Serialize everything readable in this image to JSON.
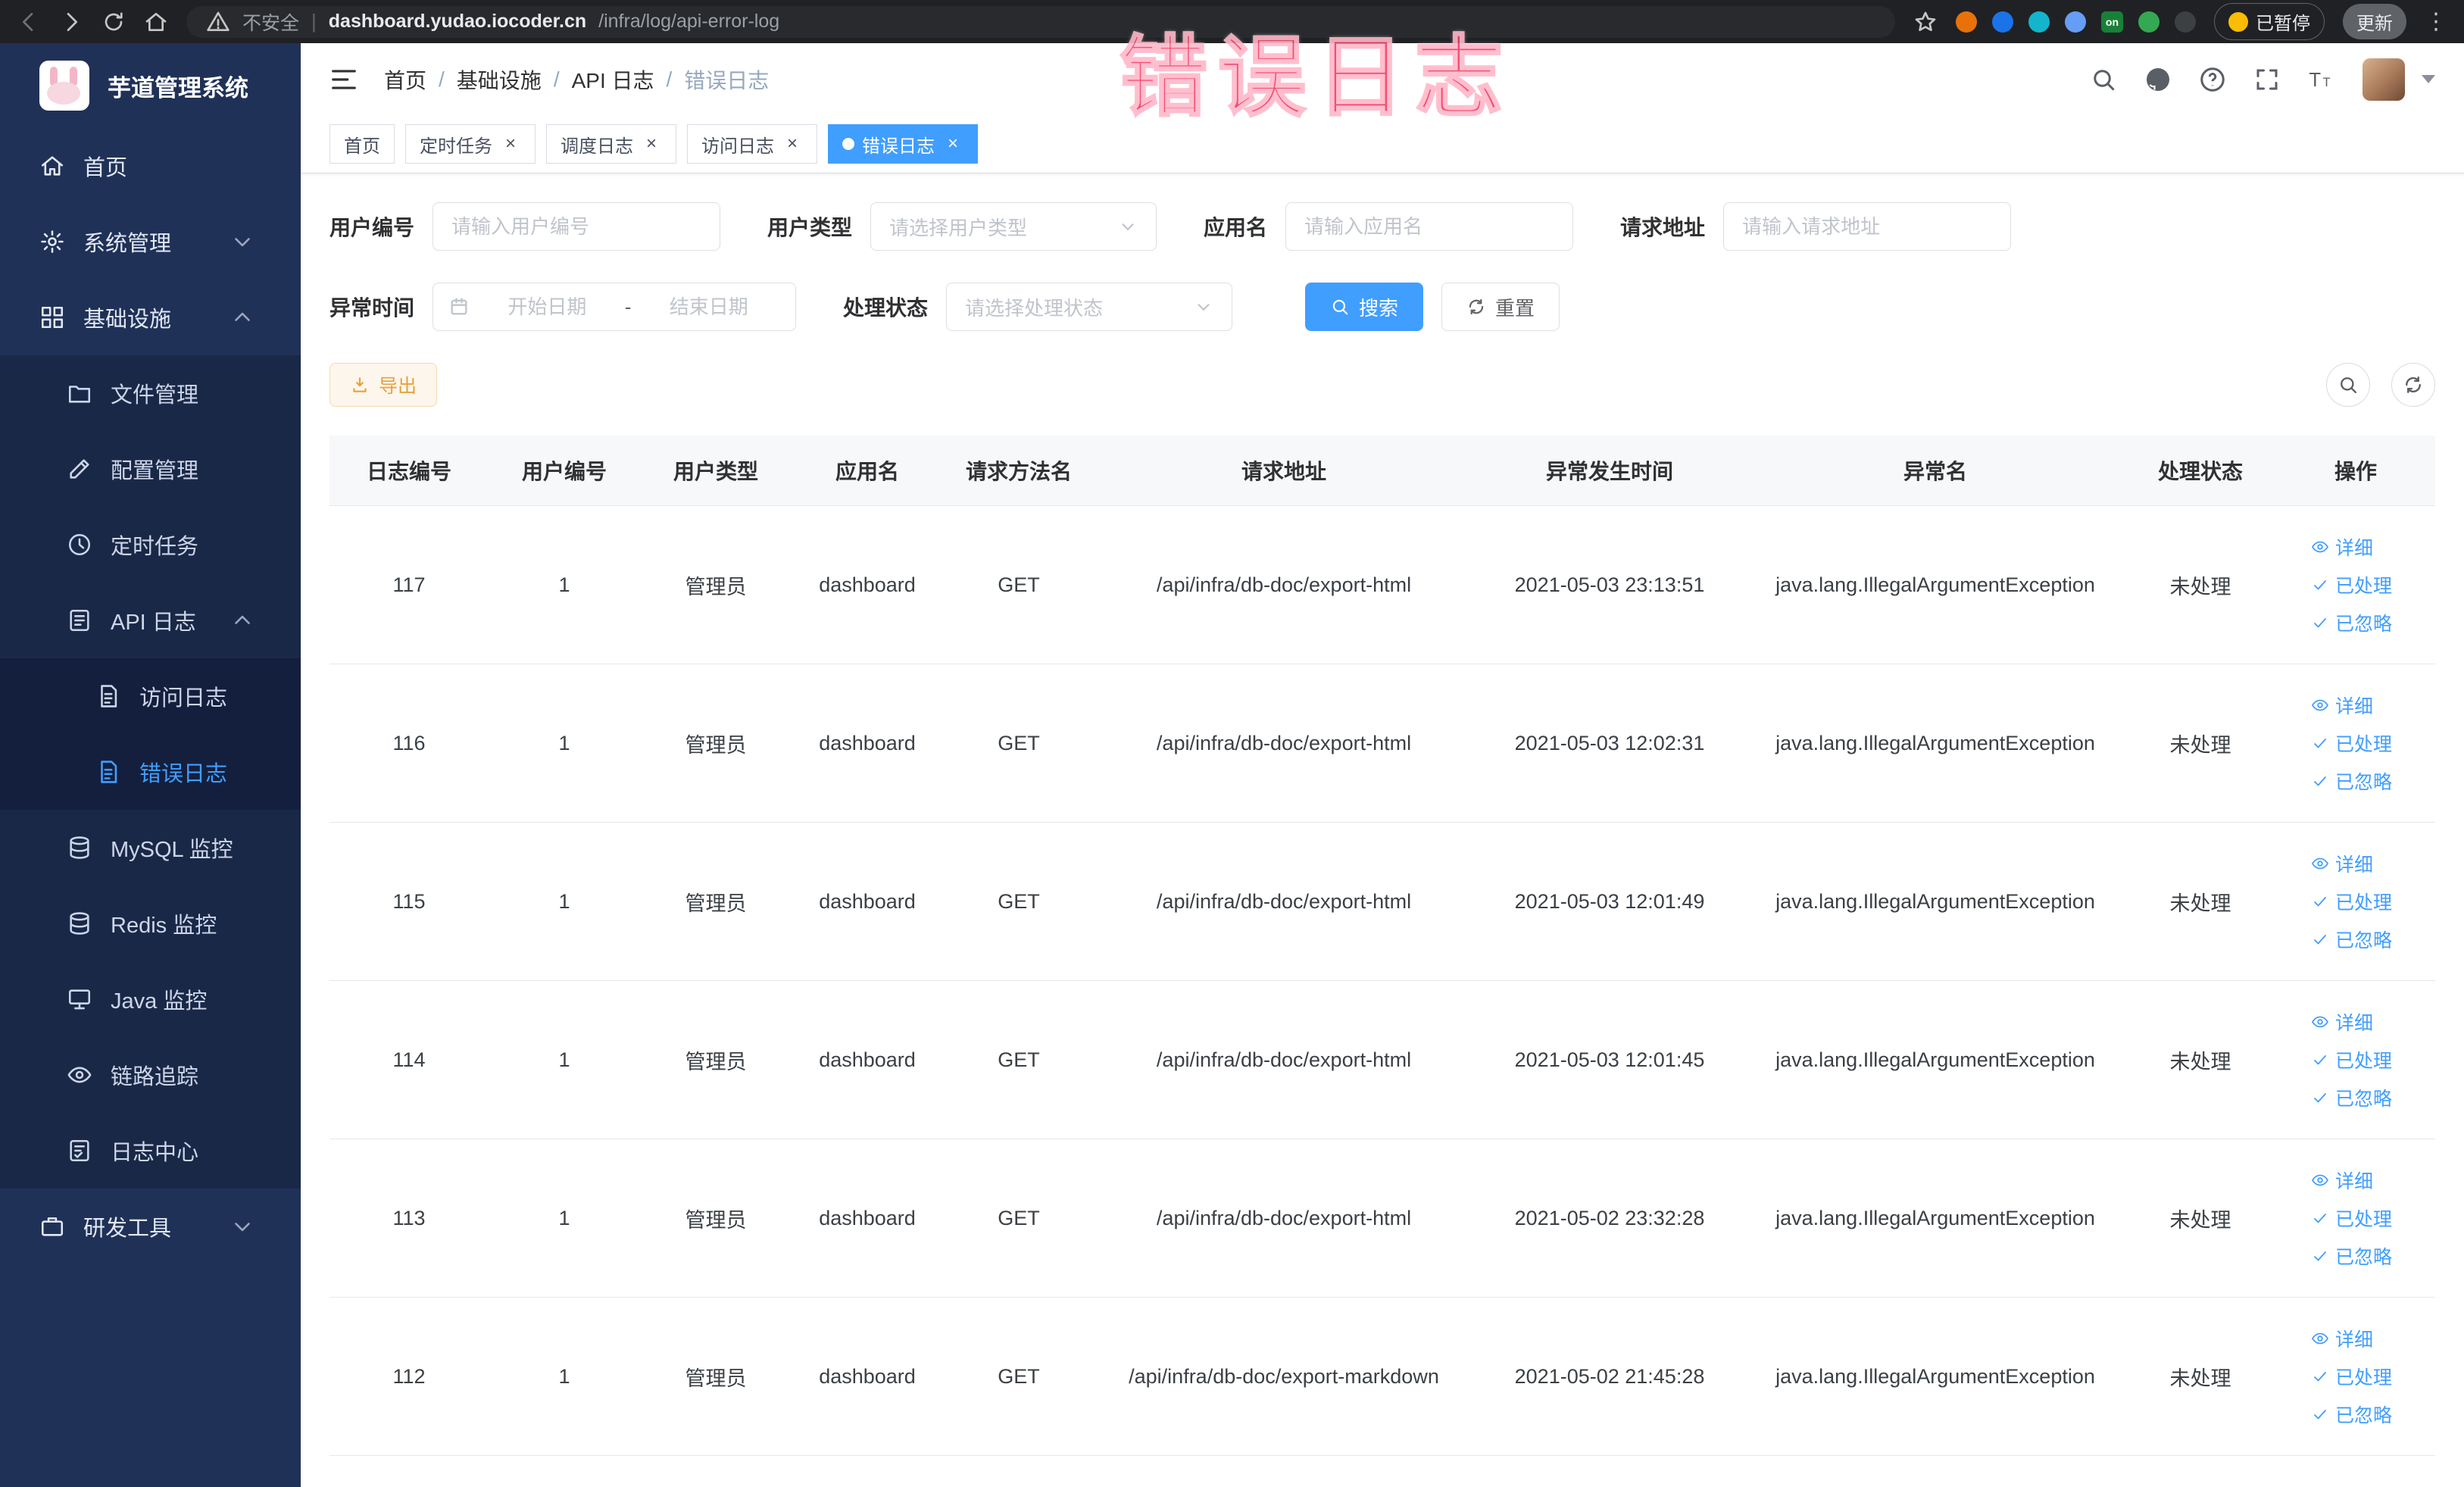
{
  "colors": {
    "accent": "#409eff",
    "warning": "#e6a23c",
    "sidebar_bg": "#203157",
    "active_tab_bg": "#409eff"
  },
  "browser": {
    "security_label": "不安全",
    "url_domain": "dashboard.yudao.iocoder.cn",
    "url_path": "/infra/log/api-error-log",
    "paused_label": "已暂停",
    "update_label": "更新",
    "extensions": [
      {
        "name": "extension-red",
        "color": "#e8710a",
        "label": ""
      },
      {
        "name": "extension-blue",
        "color": "#1a73e8",
        "label": ""
      },
      {
        "name": "extension-teal",
        "color": "#12b5cb",
        "label": ""
      },
      {
        "name": "extension-grid",
        "color": "#669df6",
        "label": ""
      },
      {
        "name": "extension-on-badge",
        "color": "#188038",
        "label": "on"
      },
      {
        "name": "extension-green",
        "color": "#34a853",
        "label": ""
      },
      {
        "name": "extension-dark",
        "color": "#3c4043",
        "label": ""
      }
    ]
  },
  "overlay_text": "错误日志",
  "sidebar": {
    "title": "芋道管理系统",
    "menu": [
      {
        "label": "首页",
        "icon": "home-icon",
        "level": 1
      },
      {
        "label": "系统管理",
        "icon": "gear-icon",
        "level": 1,
        "chevron": "down"
      },
      {
        "label": "基础设施",
        "icon": "infra-icon",
        "level": 1,
        "chevron": "up"
      },
      {
        "label": "文件管理",
        "icon": "folder-icon",
        "level": 2
      },
      {
        "label": "配置管理",
        "icon": "edit-icon",
        "level": 2
      },
      {
        "label": "定时任务",
        "icon": "clock-icon",
        "level": 2
      },
      {
        "label": "API 日志",
        "icon": "api-log-icon",
        "level": 2,
        "chevron": "up"
      },
      {
        "label": "访问日志",
        "icon": "doc-icon",
        "level": 3
      },
      {
        "label": "错误日志",
        "icon": "doc-icon",
        "level": 3,
        "active": true
      },
      {
        "label": "MySQL 监控",
        "icon": "database-icon",
        "level": 2
      },
      {
        "label": "Redis 监控",
        "icon": "database-icon",
        "level": 2
      },
      {
        "label": "Java 监控",
        "icon": "monitor-icon",
        "level": 2
      },
      {
        "label": "链路追踪",
        "icon": "trace-icon",
        "level": 2
      },
      {
        "label": "日志中心",
        "icon": "log-center-icon",
        "level": 2
      },
      {
        "label": "研发工具",
        "icon": "tools-icon",
        "level": 1,
        "chevron": "down"
      }
    ]
  },
  "breadcrumb": [
    "首页",
    "基础设施",
    "API 日志",
    "错误日志"
  ],
  "tabs": [
    {
      "label": "首页",
      "closable": false,
      "active": false
    },
    {
      "label": "定时任务",
      "closable": true,
      "active": false
    },
    {
      "label": "调度日志",
      "closable": true,
      "active": false
    },
    {
      "label": "访问日志",
      "closable": true,
      "active": false
    },
    {
      "label": "错误日志",
      "closable": true,
      "active": true
    }
  ],
  "filters": {
    "user_id": {
      "label": "用户编号",
      "placeholder": "请输入用户编号"
    },
    "user_type": {
      "label": "用户类型",
      "placeholder": "请选择用户类型"
    },
    "app_name": {
      "label": "应用名",
      "placeholder": "请输入应用名"
    },
    "request_url": {
      "label": "请求地址",
      "placeholder": "请输入请求地址"
    },
    "exception_time": {
      "label": "异常时间",
      "start_placeholder": "开始日期",
      "end_placeholder": "结束日期"
    },
    "process_status": {
      "label": "处理状态",
      "placeholder": "请选择处理状态"
    },
    "search_label": "搜索",
    "reset_label": "重置"
  },
  "toolbar": {
    "export_label": "导出"
  },
  "table": {
    "columns": [
      "日志编号",
      "用户编号",
      "用户类型",
      "应用名",
      "请求方法名",
      "请求地址",
      "异常发生时间",
      "异常名",
      "处理状态",
      "操作"
    ],
    "actions": {
      "detail": "详细",
      "processed": "已处理",
      "ignored": "已忽略"
    },
    "rows": [
      {
        "id": "117",
        "user_id": "1",
        "user_type": "管理员",
        "app": "dashboard",
        "method": "GET",
        "url": "/api/infra/db-doc/export-html",
        "time": "2021-05-03 23:13:51",
        "exception": "java.lang.IllegalArgumentException",
        "status": "未处理"
      },
      {
        "id": "116",
        "user_id": "1",
        "user_type": "管理员",
        "app": "dashboard",
        "method": "GET",
        "url": "/api/infra/db-doc/export-html",
        "time": "2021-05-03 12:02:31",
        "exception": "java.lang.IllegalArgumentException",
        "status": "未处理"
      },
      {
        "id": "115",
        "user_id": "1",
        "user_type": "管理员",
        "app": "dashboard",
        "method": "GET",
        "url": "/api/infra/db-doc/export-html",
        "time": "2021-05-03 12:01:49",
        "exception": "java.lang.IllegalArgumentException",
        "status": "未处理"
      },
      {
        "id": "114",
        "user_id": "1",
        "user_type": "管理员",
        "app": "dashboard",
        "method": "GET",
        "url": "/api/infra/db-doc/export-html",
        "time": "2021-05-03 12:01:45",
        "exception": "java.lang.IllegalArgumentException",
        "status": "未处理"
      },
      {
        "id": "113",
        "user_id": "1",
        "user_type": "管理员",
        "app": "dashboard",
        "method": "GET",
        "url": "/api/infra/db-doc/export-html",
        "time": "2021-05-02 23:32:28",
        "exception": "java.lang.IllegalArgumentException",
        "status": "未处理"
      },
      {
        "id": "112",
        "user_id": "1",
        "user_type": "管理员",
        "app": "dashboard",
        "method": "GET",
        "url": "/api/infra/db-doc/export-markdown",
        "time": "2021-05-02 21:45:28",
        "exception": "java.lang.IllegalArgumentException",
        "status": "未处理"
      }
    ]
  }
}
